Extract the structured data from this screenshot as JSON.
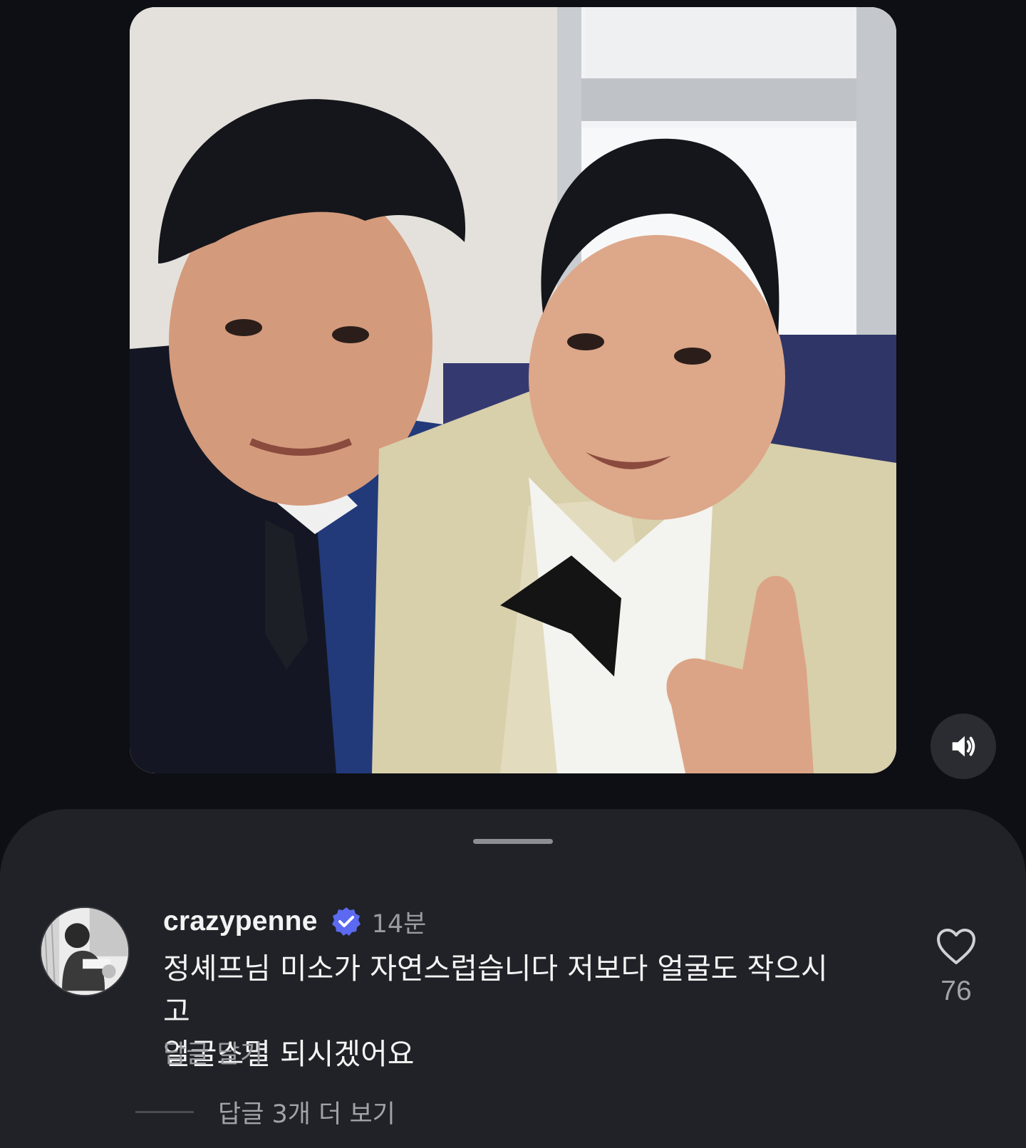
{
  "media": {
    "type": "photo",
    "icons": {
      "mute_toggle": "volume-icon"
    }
  },
  "comment": {
    "username": "crazypenne",
    "verified": true,
    "timestamp": "14분",
    "text": "정셰프님 미소가 자연스럽습니다 저보다 얼굴도 작으시고\n얼굴소멸 되시겠어요",
    "reply_label": "답글 달기",
    "like_count": "76",
    "more_replies_label": "답글 3개 더 보기",
    "icons": {
      "verified": "verified-badge-icon",
      "like": "heart-icon"
    }
  },
  "colors": {
    "background": "#0e0f14",
    "sheet": "#212227",
    "verified_badge": "#5b6af0",
    "secondary_text": "#9a9ba0",
    "primary_text": "#f4f4f4"
  }
}
